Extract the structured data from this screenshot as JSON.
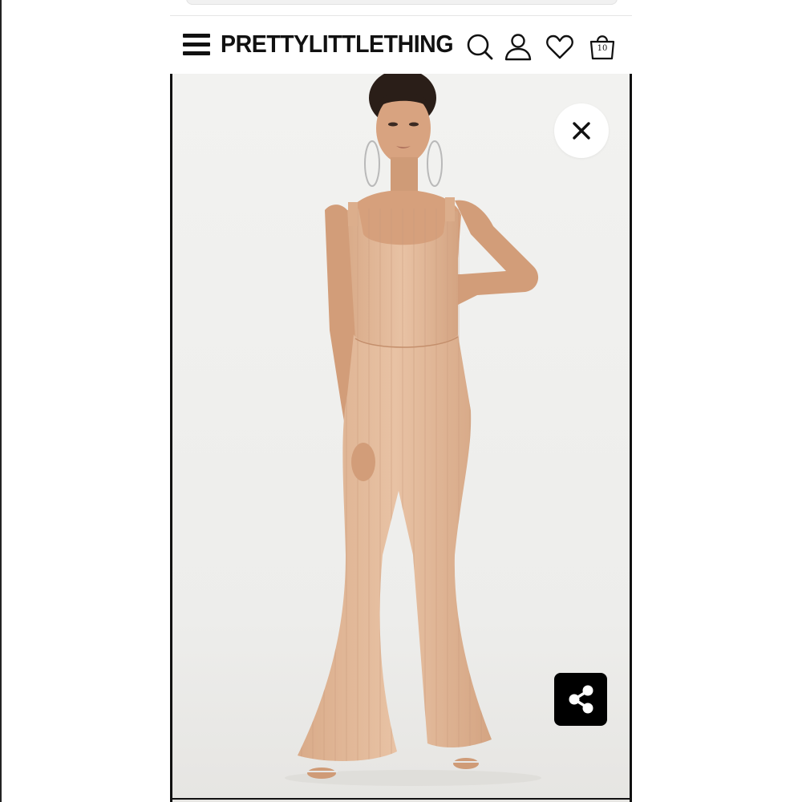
{
  "header": {
    "brand_logo": "PRETTYLITTLETHING",
    "icons": [
      "menu-icon",
      "search-icon",
      "account-icon",
      "wishlist-heart-icon",
      "shopping-bag-icon"
    ],
    "bag_count": "10"
  },
  "product_image": {
    "description_colors": {
      "background": "#efefed",
      "garment": "#e3b897",
      "garment_shadow": "#c99a78",
      "skin": "#d6a07c",
      "hair": "#2a1e18"
    }
  },
  "overlay_buttons": {
    "close_icon": "close-icon",
    "share_icon": "share-icon"
  },
  "colors": {
    "header_text": "#111111",
    "share_button_bg": "#000000",
    "close_button_bg": "#ffffff"
  }
}
